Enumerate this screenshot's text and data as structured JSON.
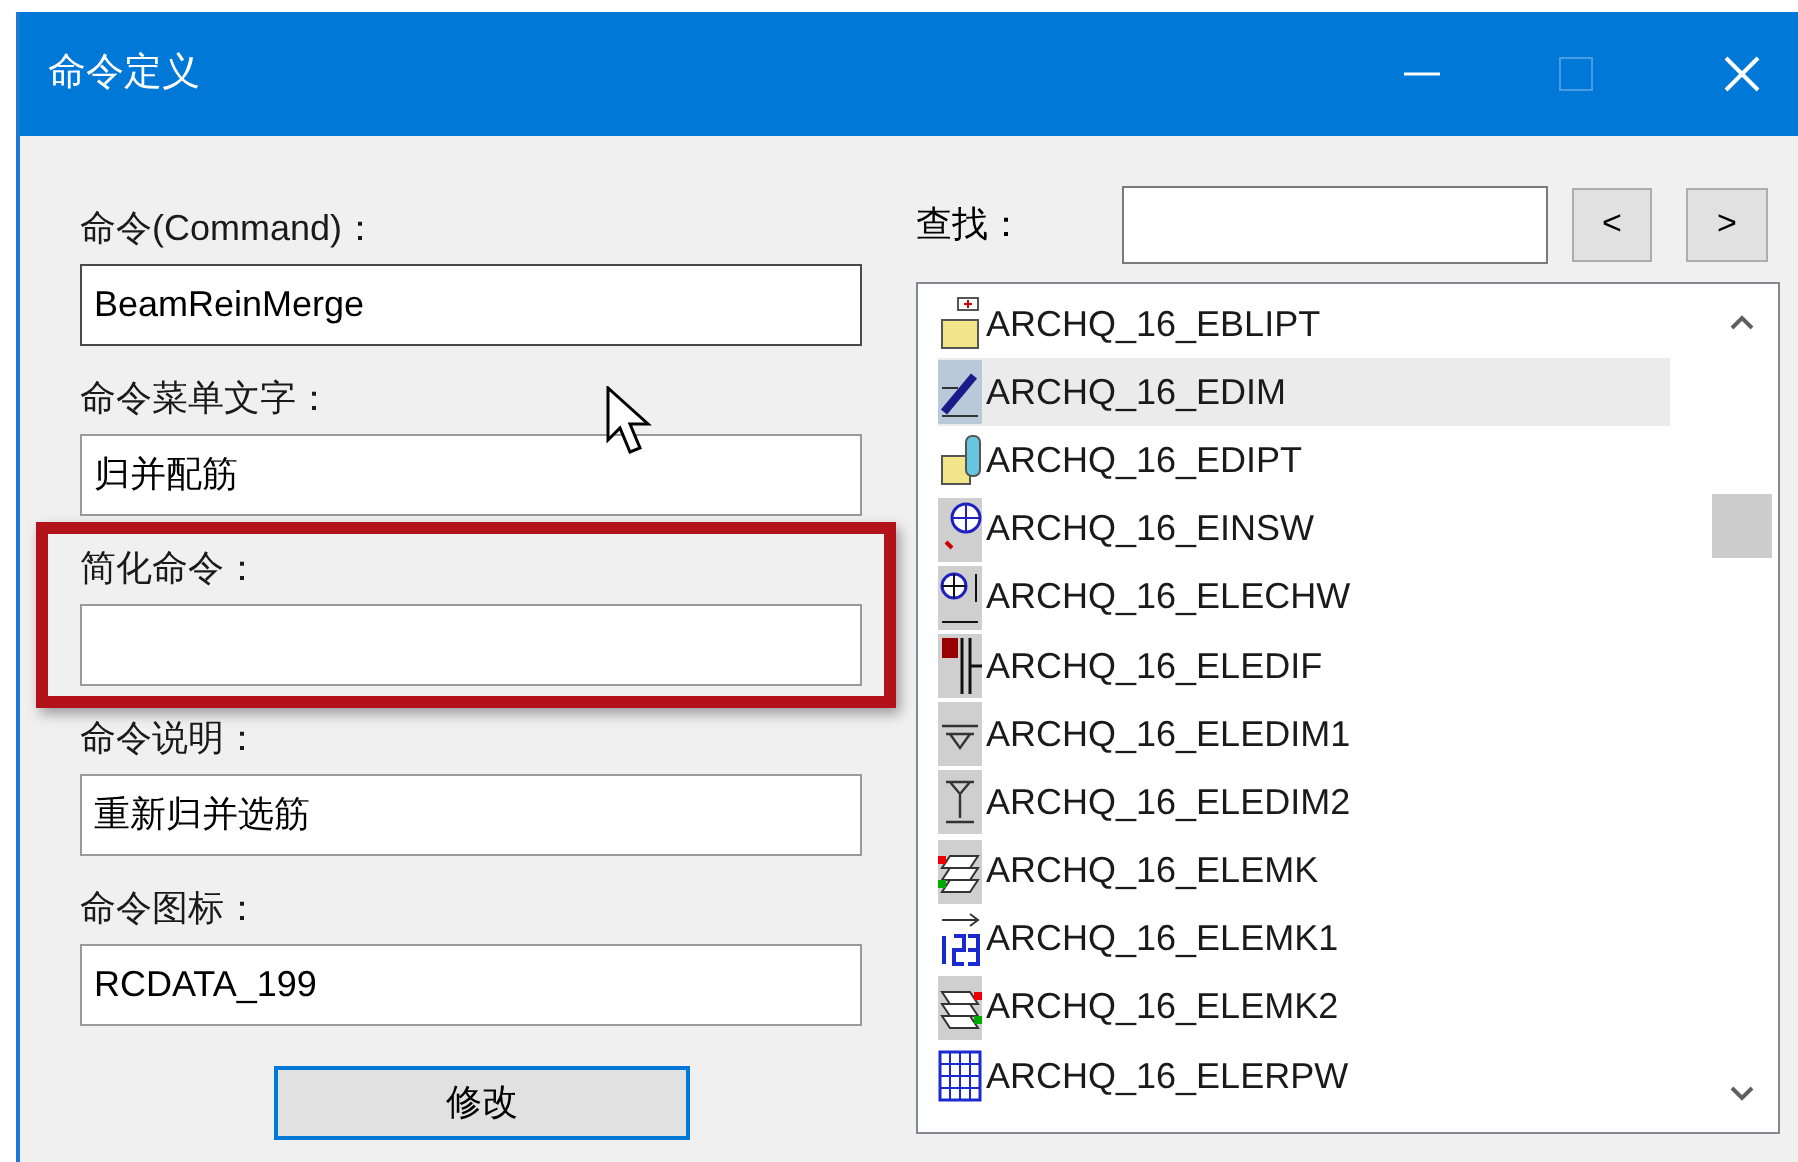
{
  "window": {
    "title": "命令定义",
    "maximize_disabled": true
  },
  "fields": [
    {
      "label": "命令(Command)：",
      "value": "BeamReinMerge",
      "highlighted": false
    },
    {
      "label": "命令菜单文字：",
      "value": "归并配筋",
      "highlighted": false
    },
    {
      "label": "简化命令：",
      "highlighted": true
    },
    {
      "label": "命令说明：",
      "value": "重新归并选筋",
      "highlighted": false
    },
    {
      "label": "命令图标：",
      "value": "RCDATA_199",
      "highlighted": false
    }
  ],
  "modify_button": "修改",
  "search": {
    "label": "查找：",
    "prev": "<",
    "next": ">"
  },
  "icon_list": [
    {
      "name": "ARCHQ_16_EBLIPT",
      "selected": false
    },
    {
      "name": "ARCHQ_16_EDIM",
      "selected": true
    },
    {
      "name": "ARCHQ_16_EDIPT",
      "selected": false
    },
    {
      "name": "ARCHQ_16_EINSW",
      "selected": false
    },
    {
      "name": "ARCHQ_16_ELECHW",
      "selected": false
    },
    {
      "name": "ARCHQ_16_ELEDIF",
      "selected": false
    },
    {
      "name": "ARCHQ_16_ELEDIM1",
      "selected": false
    },
    {
      "name": "ARCHQ_16_ELEDIM2",
      "selected": false
    },
    {
      "name": "ARCHQ_16_ELEMK",
      "selected": false
    },
    {
      "name": "ARCHQ_16_ELEMK1",
      "selected": false
    },
    {
      "name": "ARCHQ_16_ELEMK2",
      "selected": false
    },
    {
      "name": "ARCHQ_16_ELERPW",
      "selected": false
    }
  ]
}
